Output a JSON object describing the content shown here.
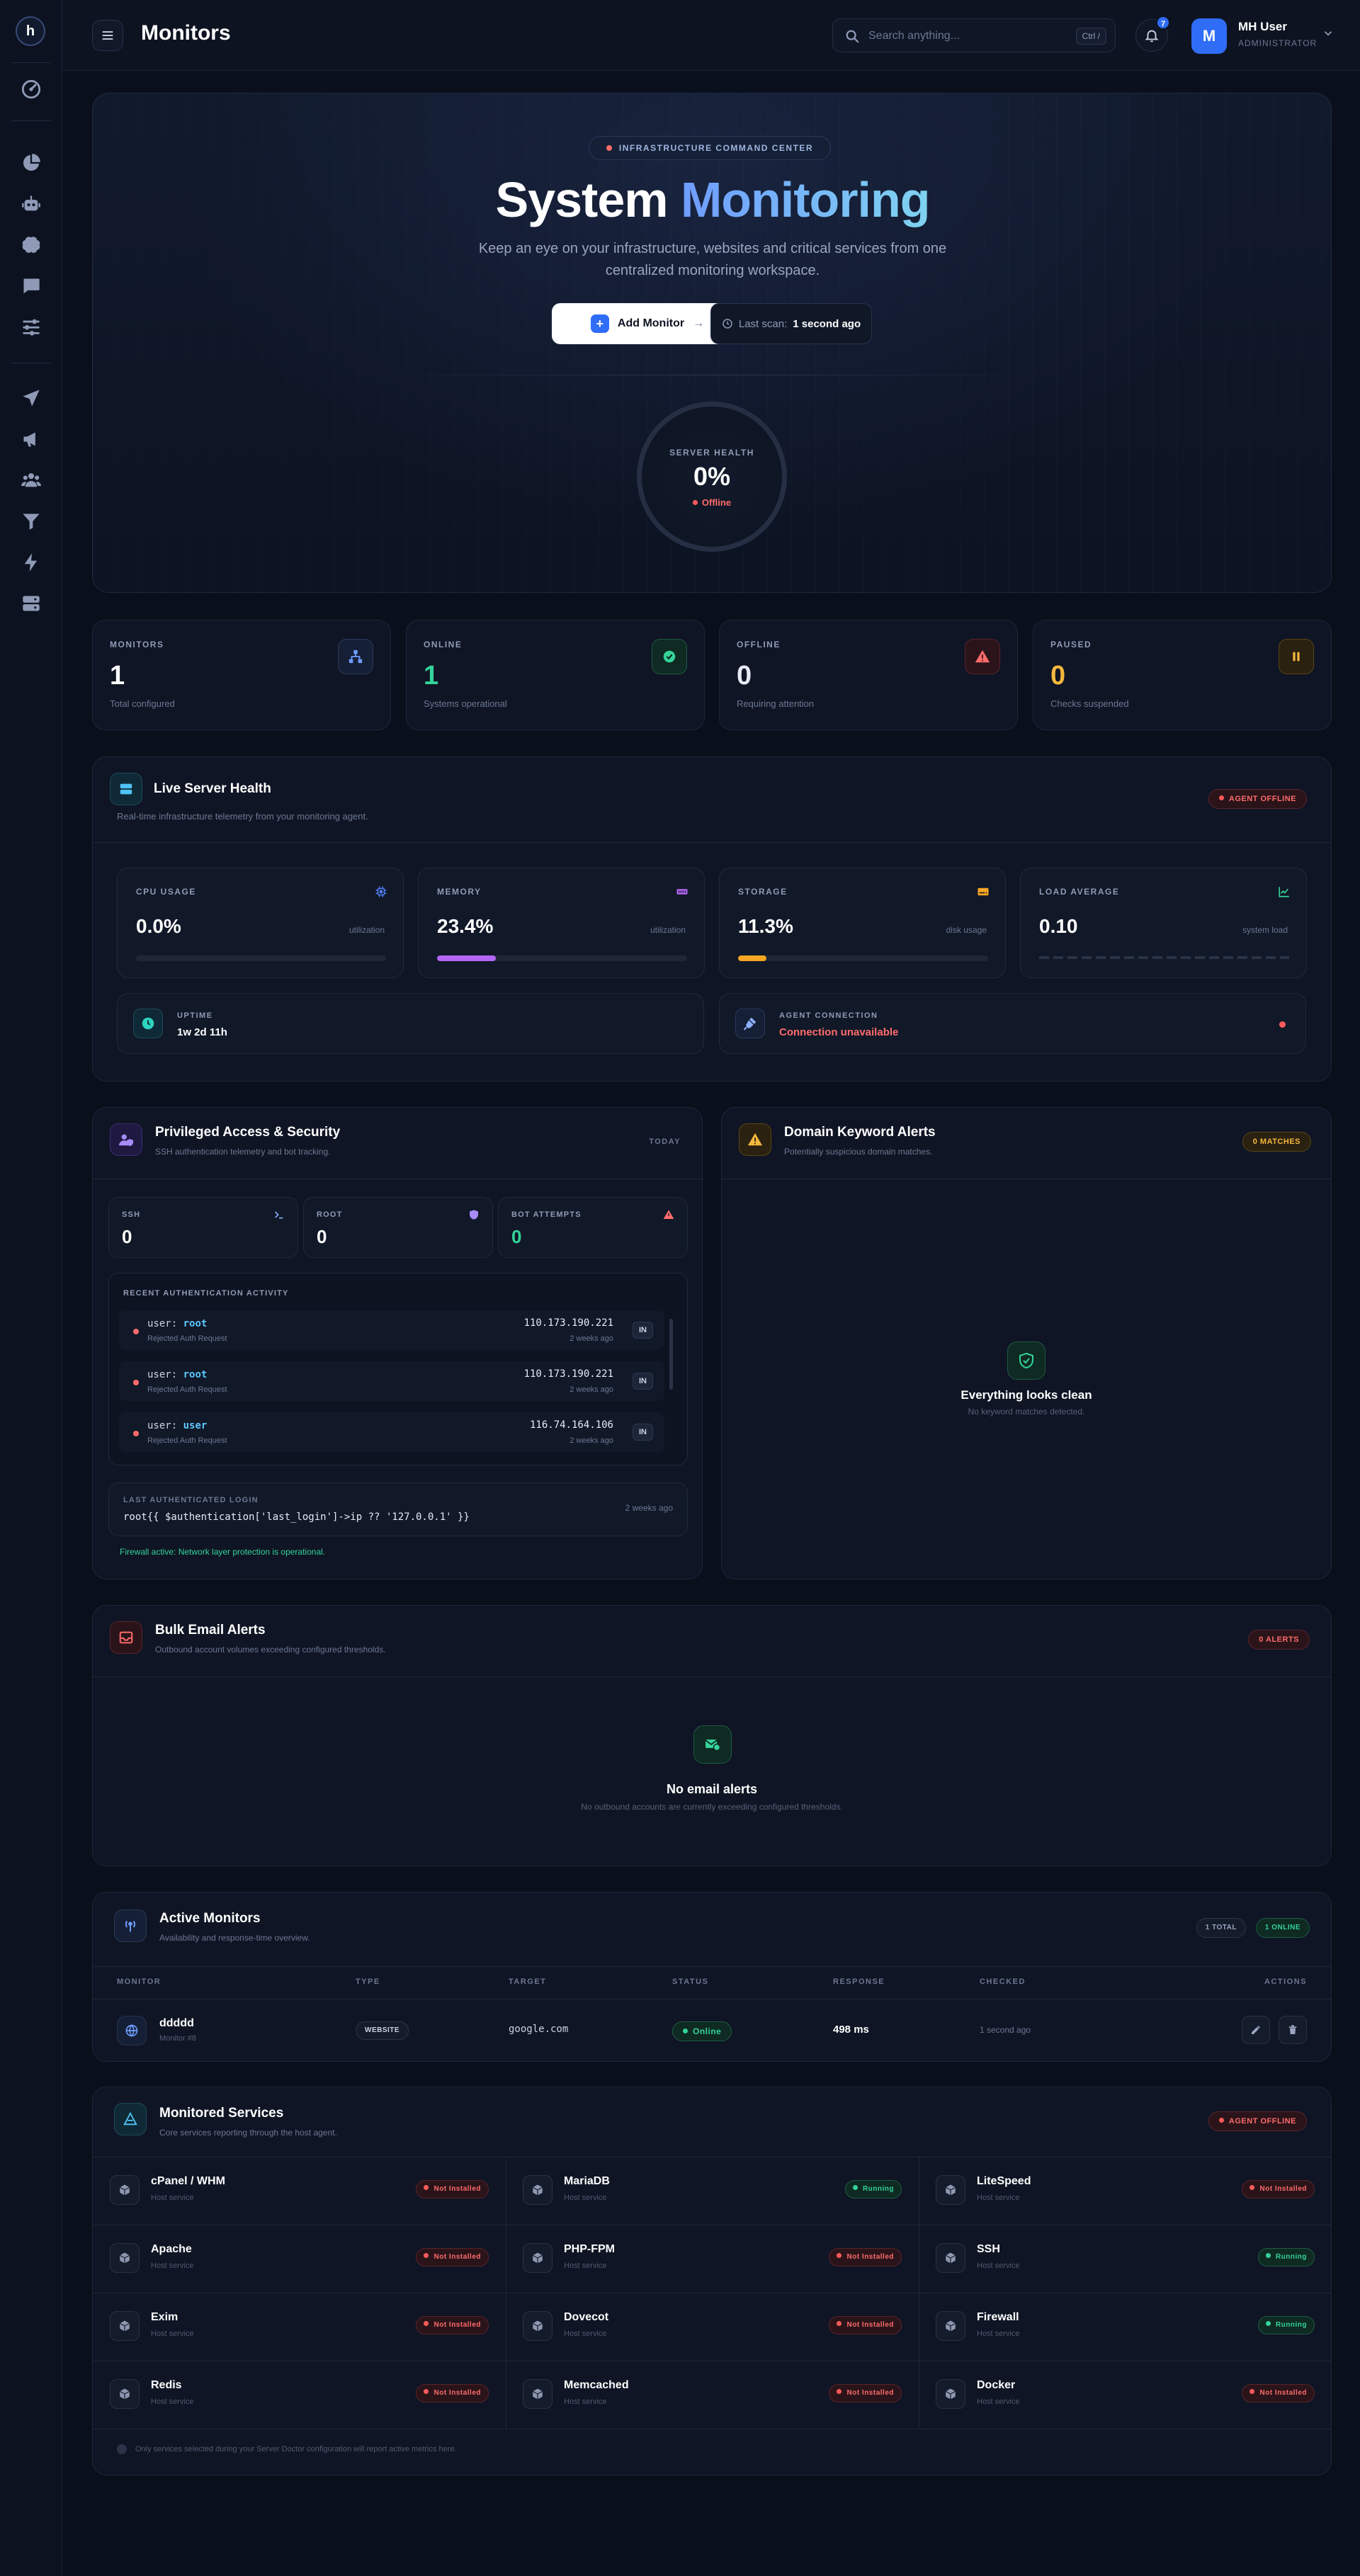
{
  "header": {
    "title": "Monitors",
    "search_placeholder": "Search anything...",
    "search_shortcut": "Ctrl /",
    "notifications": "7",
    "user_initial": "M",
    "user_name": "MH User",
    "user_role": "ADMINISTRATOR"
  },
  "sidebar": {
    "logo": "h",
    "items": [
      "dashboard-icon",
      "pie-chart-icon",
      "robot-icon",
      "brain-icon",
      "chat-icon",
      "sliders-icon",
      "send-icon",
      "megaphone-icon",
      "users-icon",
      "filter-icon",
      "bolt-icon",
      "server-icon"
    ]
  },
  "hero": {
    "badge": "INFRASTRUCTURE COMMAND CENTER",
    "title_main": "System",
    "title_accent": "Monitoring",
    "description": "Keep an eye on your infrastructure, websites and critical services from one centralized monitoring workspace.",
    "add_button": "Add Monitor",
    "last_scan_label": "Last scan:",
    "last_scan_value": "1 second ago",
    "gauge_label": "SERVER HEALTH",
    "gauge_value": "0%",
    "gauge_status": "Offline"
  },
  "stats": [
    {
      "label": "MONITORS",
      "value": "1",
      "sub": "Total configured",
      "color": "#ffffff"
    },
    {
      "label": "ONLINE",
      "value": "1",
      "sub": "Systems operational",
      "color": "#34d399"
    },
    {
      "label": "OFFLINE",
      "value": "0",
      "sub": "Requiring attention",
      "color": "#e6ebf5"
    },
    {
      "label": "PAUSED",
      "value": "0",
      "sub": "Checks suspended",
      "color": "#f5b83d"
    }
  ],
  "live": {
    "title": "Live Server Health",
    "subtitle": "Real-time infrastructure telemetry from your monitoring agent.",
    "status": "AGENT OFFLINE",
    "metrics": [
      {
        "label": "CPU USAGE",
        "value": "0.0%",
        "unit": "utilization",
        "fill": 0.0,
        "color": "#4f7df6"
      },
      {
        "label": "MEMORY",
        "value": "23.4%",
        "unit": "utilization",
        "fill": 0.234,
        "color": "#b466f5"
      },
      {
        "label": "STORAGE",
        "value": "11.3%",
        "unit": "disk usage",
        "fill": 0.113,
        "color": "#f5a623"
      },
      {
        "label": "LOAD AVERAGE",
        "value": "0.10",
        "unit": "system load",
        "fill": 0.0,
        "color": "#34d399"
      }
    ],
    "uptime_label": "UPTIME",
    "uptime_value": "1w 2d 11h",
    "agent_label": "AGENT CONNECTION",
    "agent_value": "Connection unavailable"
  },
  "security": {
    "title": "Privileged Access & Security",
    "subtitle": "SSH authentication telemetry and bot tracking.",
    "period": "TODAY",
    "ssh_label": "SSH",
    "ssh_value": "0",
    "root_label": "ROOT",
    "root_value": "0",
    "bot_label": "BOT ATTEMPTS",
    "bot_value": "0",
    "activity_title": "RECENT AUTHENTICATION ACTIVITY",
    "user_prefix": "user:",
    "activity": [
      {
        "user": "root",
        "note": "Rejected Auth Request",
        "ip": "110.173.190.221",
        "time": "2 weeks ago",
        "dir": "IN"
      },
      {
        "user": "root",
        "note": "Rejected Auth Request",
        "ip": "110.173.190.221",
        "time": "2 weeks ago",
        "dir": "IN"
      },
      {
        "user": "user",
        "note": "Rejected Auth Request",
        "ip": "116.74.164.106",
        "time": "2 weeks ago",
        "dir": "IN"
      }
    ],
    "last_login_label": "LAST AUTHENTICATED LOGIN",
    "last_login_value": "root{{ $authentication['last_login']->ip ?? '127.0.0.1' }}",
    "last_login_time": "2 weeks ago",
    "firewall": "Firewall active: Network layer protection is operational."
  },
  "keywords": {
    "title": "Domain Keyword Alerts",
    "subtitle": "Potentially suspicious domain matches.",
    "count": "0 MATCHES",
    "empty_title": "Everything looks clean",
    "empty_sub": "No keyword matches detected."
  },
  "bulk": {
    "title": "Bulk Email Alerts",
    "subtitle": "Outbound account volumes exceeding configured thresholds.",
    "count": "0 ALERTS",
    "empty_title": "No email alerts",
    "empty_sub": "No outbound accounts are currently exceeding configured thresholds."
  },
  "monitors": {
    "title": "Active Monitors",
    "subtitle": "Availability and response-time overview.",
    "total": "1 TOTAL",
    "online": "1 ONLINE",
    "columns": [
      "MONITOR",
      "TYPE",
      "TARGET",
      "STATUS",
      "RESPONSE",
      "CHECKED",
      "ACTIONS"
    ],
    "row": {
      "name": "ddddd",
      "id": "Monitor #8",
      "type": "WEBSITE",
      "target": "google.com",
      "status": "Online",
      "response": "498 ms",
      "checked": "1 second ago"
    }
  },
  "services": {
    "title": "Monitored Services",
    "subtitle": "Core services reporting through the host agent.",
    "status": "AGENT OFFLINE",
    "host_label": "Host service",
    "items": [
      {
        "name": "cPanel / WHM",
        "state": "Not Installed"
      },
      {
        "name": "MariaDB",
        "state": "Running"
      },
      {
        "name": "LiteSpeed",
        "state": "Not Installed"
      },
      {
        "name": "Apache",
        "state": "Not Installed"
      },
      {
        "name": "PHP-FPM",
        "state": "Not Installed"
      },
      {
        "name": "SSH",
        "state": "Running"
      },
      {
        "name": "Exim",
        "state": "Not Installed"
      },
      {
        "name": "Dovecot",
        "state": "Not Installed"
      },
      {
        "name": "Firewall",
        "state": "Running"
      },
      {
        "name": "Redis",
        "state": "Not Installed"
      },
      {
        "name": "Memcached",
        "state": "Not Installed"
      },
      {
        "name": "Docker",
        "state": "Not Installed"
      }
    ],
    "footnote": "Only services selected during your Server Doctor configuration will report active metrics here."
  }
}
